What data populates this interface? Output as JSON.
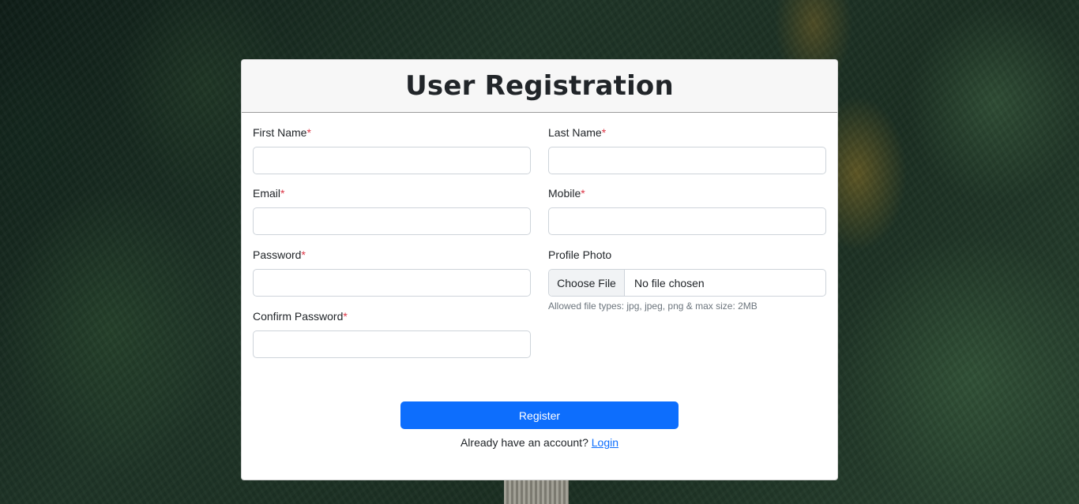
{
  "page": {
    "title": "User Registration",
    "accent_color": "#0d6efd",
    "required_marker": "*"
  },
  "form": {
    "first_name": {
      "label": "First Name",
      "value": ""
    },
    "last_name": {
      "label": "Last Name",
      "value": ""
    },
    "email": {
      "label": "Email",
      "value": ""
    },
    "mobile": {
      "label": "Mobile",
      "value": ""
    },
    "password": {
      "label": "Password",
      "value": ""
    },
    "confirm_password": {
      "label": "Confirm Password",
      "value": ""
    },
    "profile_photo": {
      "label": "Profile Photo",
      "button_label": "Choose File",
      "status": "No file chosen",
      "hint": "Allowed file types: jpg, jpeg, png & max size: 2MB"
    }
  },
  "actions": {
    "register_label": "Register",
    "login_prompt": "Already have an account?",
    "login_link": "Login"
  }
}
